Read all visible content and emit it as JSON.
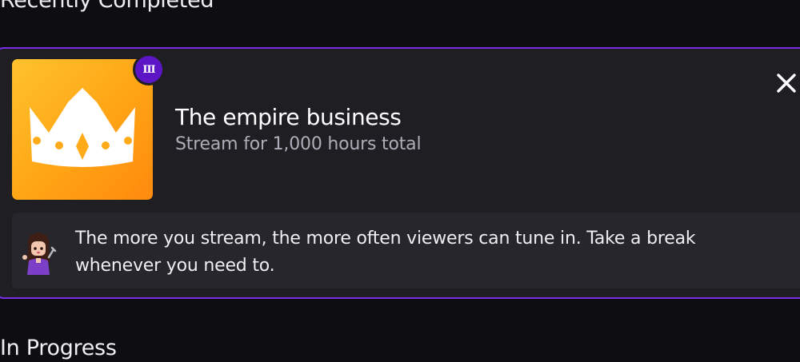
{
  "sections": {
    "completed_heading": "Recently Completed",
    "in_progress_heading": "In Progress"
  },
  "achievement": {
    "title": "The empire business",
    "description": "Stream for 1,000 hours total",
    "tier": "III",
    "icon": "crown-icon",
    "tip": "The more you stream, the more often viewers can tune in. Take a break whenever you need to."
  },
  "colors": {
    "background": "#0e0e10",
    "card": "#1f1f23",
    "card_border": "#772ce8",
    "tier_badge": "#5c16c5",
    "badge_gradient_start": "#ffc22e",
    "badge_gradient_end": "#ff8a0d"
  }
}
